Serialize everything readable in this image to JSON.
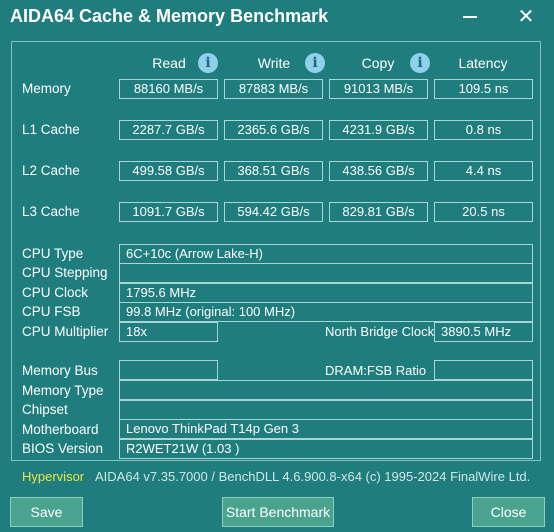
{
  "window": {
    "title": "AIDA64 Cache & Memory Benchmark",
    "minimize_icon": "minimize-icon",
    "close_glyph": "✕",
    "close_icon": "close-icon"
  },
  "columns": {
    "read": "Read",
    "write": "Write",
    "copy": "Copy",
    "latency": "Latency",
    "info_glyph": "i",
    "info_icon": "info-icon"
  },
  "rows": [
    {
      "label": "Memory",
      "read": "88160 MB/s",
      "write": "87883 MB/s",
      "copy": "91013 MB/s",
      "latency": "109.5 ns"
    },
    {
      "label": "L1 Cache",
      "read": "2287.7 GB/s",
      "write": "2365.6 GB/s",
      "copy": "4231.9 GB/s",
      "latency": "0.8 ns"
    },
    {
      "label": "L2 Cache",
      "read": "499.58 GB/s",
      "write": "368.51 GB/s",
      "copy": "438.56 GB/s",
      "latency": "4.4 ns"
    },
    {
      "label": "L3 Cache",
      "read": "1091.7 GB/s",
      "write": "594.42 GB/s",
      "copy": "829.81 GB/s",
      "latency": "20.5 ns"
    }
  ],
  "cpu": {
    "type_label": "CPU Type",
    "type_value": "6C+10c   (Arrow Lake-H)",
    "stepping_label": "CPU Stepping",
    "stepping_value": "",
    "clock_label": "CPU Clock",
    "clock_value": "1795.6 MHz",
    "fsb_label": "CPU FSB",
    "fsb_value": "99.8 MHz  (original: 100 MHz)",
    "multiplier_label": "CPU Multiplier",
    "multiplier_value": "18x",
    "northbridge_label": "North Bridge Clock",
    "northbridge_value": "3890.5 MHz"
  },
  "system": {
    "membus_label": "Memory Bus",
    "membus_value": "",
    "dram_ratio_label": "DRAM:FSB Ratio",
    "dram_ratio_value": "",
    "memtype_label": "Memory Type",
    "memtype_value": "",
    "chipset_label": "Chipset",
    "chipset_value": "",
    "motherboard_label": "Motherboard",
    "motherboard_value": "Lenovo ThinkPad T14p Gen 3",
    "bios_label": "BIOS Version",
    "bios_value": "R2WET21W (1.03 )"
  },
  "footer": {
    "hypervisor": "Hypervisor",
    "version_text": "AIDA64 v7.35.7000 / BenchDLL 4.6.900.8-x64  (c) 1995-2024 FinalWire Ltd."
  },
  "buttons": {
    "save": "Save",
    "start": "Start Benchmark",
    "close": "Close"
  }
}
